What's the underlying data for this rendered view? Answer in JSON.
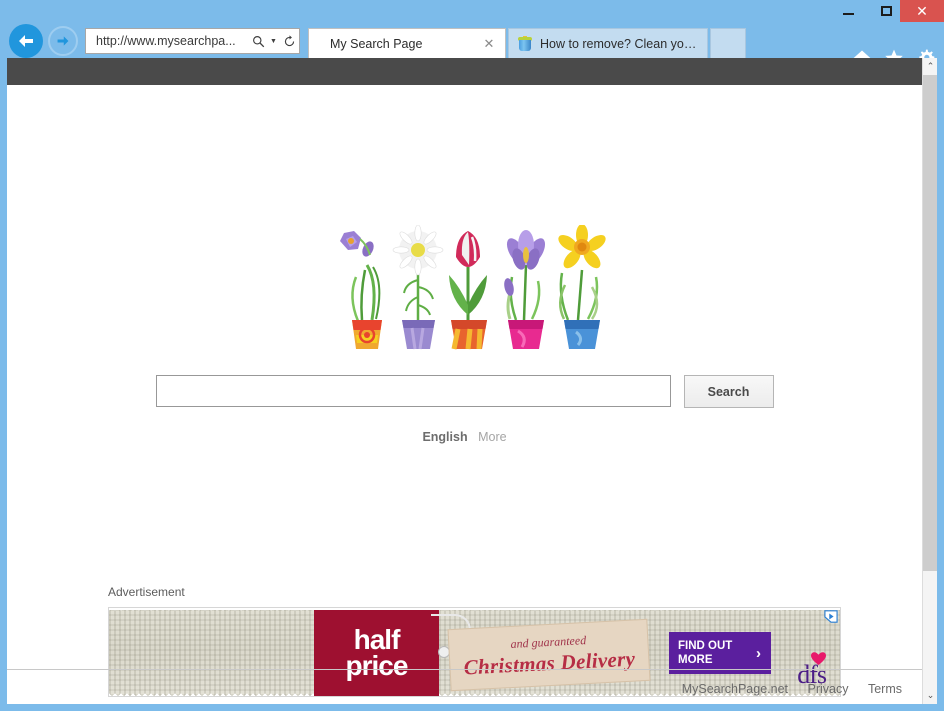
{
  "window": {
    "minimize_label": "minimize",
    "maximize_label": "maximize",
    "close_label": "✕"
  },
  "browser": {
    "back_label": "Back",
    "forward_label": "Forward",
    "address": {
      "url": "http://www.mysearchpa...",
      "search_icon": "search-icon",
      "caret_icon": "chevron-down-icon",
      "refresh_icon": "refresh-icon",
      "refresh_glyph": "↻"
    },
    "tabs": [
      {
        "title": "My Search Page",
        "close_glyph": "✕",
        "active": true
      },
      {
        "title": "How to remove? Clean your co...",
        "favicon": "recycle-bin-icon",
        "active": false
      }
    ],
    "new_tab_label": "",
    "toolbar_icons": [
      "home-icon",
      "favorites-star-icon",
      "settings-gear-icon"
    ]
  },
  "page": {
    "search": {
      "value": "",
      "placeholder": "",
      "button_label": "Search"
    },
    "language": {
      "primary": "English",
      "more": "More"
    },
    "advertisement": {
      "label": "Advertisement",
      "adchoices_icon": "adchoices-icon",
      "tag_line1": "half",
      "tag_line2": "price",
      "kraft_line1": "and guaranteed",
      "kraft_line2": "Christmas Delivery",
      "cta_line1": "FIND OUT",
      "cta_line2": "MORE",
      "cta_arrow": "›",
      "brand": "dfs"
    },
    "footer": {
      "site": "MySearchPage.net",
      "privacy": "Privacy",
      "terms": "Terms"
    }
  },
  "scrollbar": {
    "up_glyph": "⌃",
    "down_glyph": "⌄"
  },
  "colors": {
    "chrome_blue": "#7cbbea",
    "accent_blue": "#2196dd",
    "close_red": "#d9534f",
    "topbar_dark": "#4a4a4a",
    "ad_red": "#9e1030",
    "ad_purple": "#5b1f9e"
  }
}
